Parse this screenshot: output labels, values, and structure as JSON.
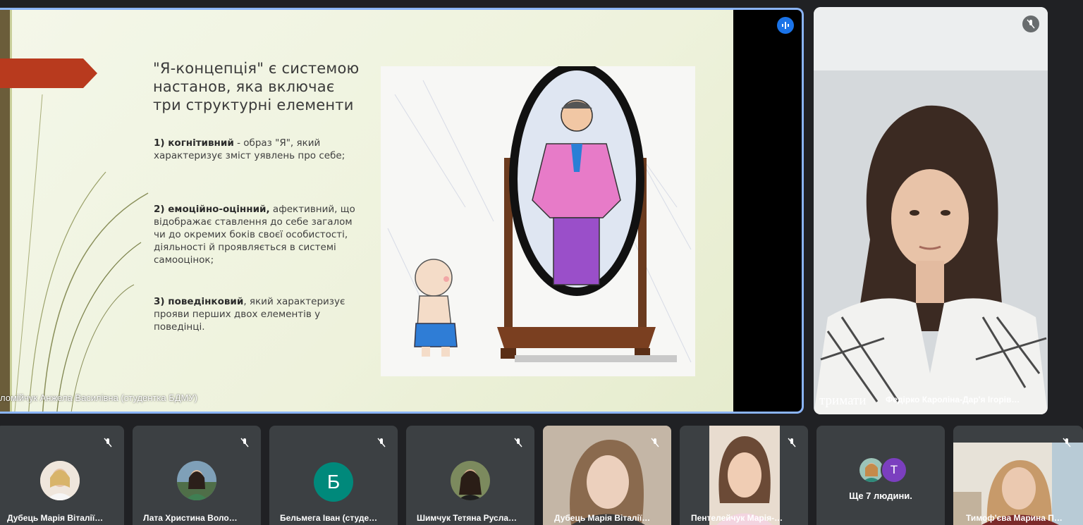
{
  "main": {
    "slide_title": "\"Я-концепція\" є системою настанов, яка включає три структурні елементи",
    "items": [
      {
        "bold": "1) когнітивний",
        "rest": " - образ \"Я\", який характеризує зміст уявлень про себе;"
      },
      {
        "bold": "2) емоційно-оцінний,",
        "rest": " афективний, що відображає ставлення до себе загалом чи до окремих боків своєї особистості, діяльності й проявляється в системі самооцінок;"
      },
      {
        "bold": "3) поведінковий",
        "rest": ", який характеризує прояви перших двох елементів у поведінці."
      }
    ],
    "presenter_name": "ломійчук Анжела Василівна (студентка БДМУ)",
    "accent": "#8ab4f8"
  },
  "side": {
    "caption": "тримати",
    "name": "Федірко Кароліна-Дар'я Ігорів…"
  },
  "participants": [
    {
      "name": "Дубець Марія Віталії…",
      "type": "photo",
      "avatar_color": "#d9c7b5"
    },
    {
      "name": "Лата Христина Воло…",
      "type": "photo",
      "avatar_color": "#5c7d5a"
    },
    {
      "name": "Бельмега Іван (студе…",
      "type": "letter",
      "letter": "Б",
      "avatar_color": "#00897b"
    },
    {
      "name": "Шимчук Тетяна Русла…",
      "type": "photo",
      "avatar_color": "#5a4d38"
    },
    {
      "name": "Дубець Марія Віталії…",
      "type": "video"
    },
    {
      "name": "Пентелейчук Марія-…",
      "type": "video"
    },
    {
      "name": "",
      "type": "more",
      "more_label": "Ще 7 людини.",
      "letter": "T"
    },
    {
      "name": "Тимоф'єва Марина П…",
      "type": "video"
    }
  ]
}
